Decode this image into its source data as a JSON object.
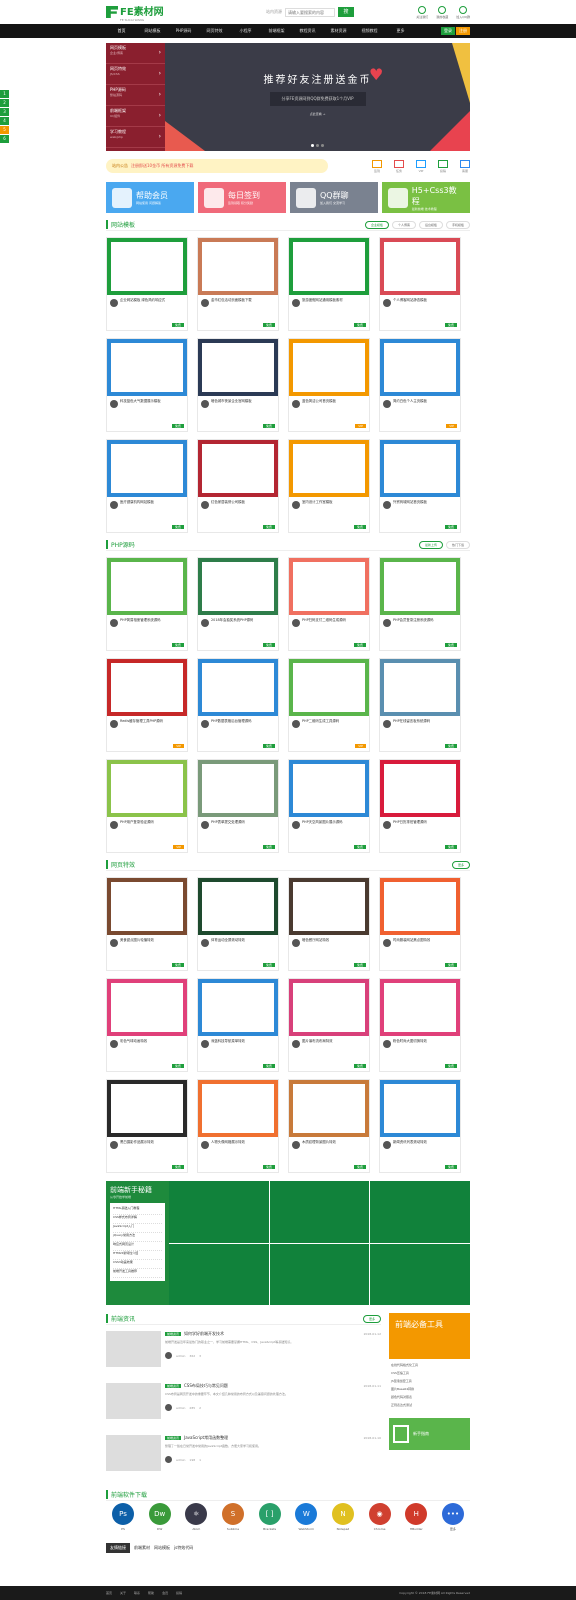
{
  "header": {
    "logo_main": "FE素材网",
    "logo_sub": "FE SUCAI WANG",
    "search_label": "站内资源",
    "search_placeholder": "请输入要搜索的内容",
    "search_btn": "搜",
    "tools": [
      "关注我们",
      "我的收藏",
      "加入QQ群"
    ]
  },
  "nav": {
    "items": [
      "首页",
      "网站模板",
      "PHP源码",
      "网页特效",
      "小程序",
      "前端框架",
      "教程资讯",
      "素材资源",
      "视频教程",
      "更多"
    ],
    "login": "登录",
    "register": "注册"
  },
  "side_tabs": [
    "1",
    "2",
    "3",
    "4",
    "5",
    "6"
  ],
  "banner": {
    "menu": [
      {
        "t": "网页模板",
        "s": "企业/博客"
      },
      {
        "t": "网页特效",
        "s": "JS/CSS"
      },
      {
        "t": "PHP源码",
        "s": "整站源码"
      },
      {
        "t": "前端框架",
        "s": "UI/组件"
      },
      {
        "t": "学习教程",
        "s": "web/php"
      }
    ],
    "title": "推荐好友注册送金币",
    "sub": "分享FE资源网到QQ群免费获取1个月VIP",
    "link": "点此查看 →"
  },
  "notice": {
    "label": "站内公告",
    "text": "注册即送10金币 所有资源免费下载"
  },
  "quick": [
    "签到",
    "任务",
    "VIP",
    "投稿",
    "客服"
  ],
  "promos": [
    {
      "t": "帮助会员",
      "s": "网站使用 问题解答",
      "c": "#4aa8f0"
    },
    {
      "t": "每日签到",
      "s": "签到领取 积分奖励",
      "c": "#f06a7a"
    },
    {
      "t": "QQ群聊",
      "s": "加入我们 交流学习",
      "c": "#7a8290"
    },
    {
      "t": "H5+Css3教程",
      "s": "最新前端 技术教程",
      "c": "#7ac043"
    }
  ],
  "sections": [
    {
      "title": "网站模板",
      "tabs": [
        "企业模板",
        "个人博客",
        "后台模板",
        "手机模板"
      ],
      "cards": [
        [
          "#1e9e3c",
          "企业网站模板 绿色简约响应式",
          "免费"
        ],
        [
          "#c97a56",
          "金币红包活动页面模板下载",
          "免费"
        ],
        [
          "#1e9e3c",
          "旅游度假网站通用模板素材",
          "免费"
        ],
        [
          "#d94a55",
          "个人博客网站静态模板",
          "免费"
        ],
        [
          "#2d89d6",
          "科技蓝色大气数据展示模板",
          "免费"
        ],
        [
          "#2b3a55",
          "暗色城市夜景企业官网模板",
          "免费"
        ],
        [
          "#f39800",
          "蓝色简洁公司首页模板",
          "VIP"
        ],
        [
          "#2d89d6",
          "简约白色个人主页模板",
          "VIP"
        ],
        [
          "#2d89d6",
          "医疗健康机构网站模板",
          "免费"
        ],
        [
          "#b32632",
          "红色家居装修公司模板",
          "免费"
        ],
        [
          "#f39800",
          "室内设计工作室模板",
          "免费"
        ],
        [
          "#2d89d6",
          "外贸商城网站首页模板",
          "免费"
        ]
      ]
    },
    {
      "title": "PHP源码",
      "tabs": [
        "最新上传",
        "热门下载"
      ],
      "cards": [
        [
          "#5ab54b",
          "PHP简易相册管理系统源码",
          "免费"
        ],
        [
          "#2e7d4a",
          "2018年会抽奖系统PHP源码",
          "免费"
        ],
        [
          "#f07060",
          "PHP扫码支付二维码生成源码",
          "免费"
        ],
        [
          "#5ab54b",
          "PHP会员登录注册系统源码",
          "免费"
        ],
        [
          "#c62828",
          "Redis缓存管理工具PHP源码",
          "VIP"
        ],
        [
          "#2d89d6",
          "PHP数据表格后台管理源码",
          "免费"
        ],
        [
          "#5ab54b",
          "PHP二维码生成工具源码",
          "VIP"
        ],
        [
          "#5a8fb0",
          "PHP在线留言板系统源码",
          "免费"
        ],
        [
          "#8bc34a",
          "PHP用户登录验证源码",
          "VIP"
        ],
        [
          "#7a9a7a",
          "PHP表单提交处理源码",
          "免费"
        ],
        [
          "#2d89d6",
          "PHP天空风景图片展示源码",
          "免费"
        ],
        [
          "#d81b3c",
          "PHP日历排班管理源码",
          "免费"
        ]
      ]
    },
    {
      "title": "网页特效",
      "tabs": [
        "更多"
      ],
      "cards": [
        [
          "#7a4a30",
          "美食甜点图片轮播特效",
          "免费"
        ],
        [
          "#1e4a2e",
          "体育运动全屏滚动特效",
          "免费"
        ],
        [
          "#4a3a30",
          "暗色餐厅网站特效",
          "免费"
        ],
        [
          "#f06030",
          "时尚服装网站焦点图特效",
          "免费"
        ],
        [
          "#e0407a",
          "彩色气球动画特效",
          "免费"
        ],
        [
          "#2d89d6",
          "深蓝科技导航菜单特效",
          "免费"
        ],
        [
          "#d8407a",
          "图片瀑布流布局特效",
          "免费"
        ],
        [
          "#e0407a",
          "粉色时尚大图切换特效",
          "免费"
        ],
        [
          "#2a2a2a",
          "黑白摄影作品展示特效",
          "免费"
        ],
        [
          "#f07030",
          "人物头像网格展示特效",
          "免费"
        ],
        [
          "#c87a3a",
          "木质纹理背景图片特效",
          "免费"
        ],
        [
          "#2d89d6",
          "新闻资讯列表滚动特效",
          "免费"
        ]
      ]
    }
  ],
  "feature": {
    "title": "前端新手秘籍",
    "sub": "从零开始学前端",
    "items": [
      "HTML基础入门教程",
      "CSS样式布局详解",
      "JavaScript入门",
      "jQuery常用方法",
      "响应式网页设计",
      "HTML5新特性介绍",
      "CSS3动画效果",
      "前端开发工具推荐"
    ]
  },
  "articles": {
    "title": "前端资讯",
    "more": "更多",
    "items": [
      {
        "tag": "前端资讯",
        "title": "如何学好前端开发技术",
        "date": "2018-01-12",
        "desc": "前端开发是近年来最热门的职业之一，学习前端需要掌握HTML、CSS、JavaScript等基础知识。",
        "author": "admin",
        "views": "362",
        "likes": "3"
      },
      {
        "tag": "前端资讯",
        "title": "CSS布局技巧与常见问题",
        "date": "2018-01-11",
        "desc": "CSS布局是网页开发中的重要环节，本文介绍几种常用的布局方式以及兼容问题的处理方法。",
        "author": "admin",
        "views": "285",
        "likes": "2"
      },
      {
        "tag": "前端资讯",
        "title": "JavaScript常用函数整理",
        "date": "2018-01-10",
        "desc": "整理了一些在日常开发中常用的JavaScript函数，方便大家学习和使用。",
        "author": "admin",
        "views": "198",
        "likes": "1"
      }
    ]
  },
  "tools_box": {
    "title": "前端必备工具",
    "items": [
      "在线代码格式化工具",
      "CSS压缩工具",
      "JS混淆加密工具",
      "图片Base64转换",
      "颜色代码对照表",
      "正则表达式测试"
    ],
    "guide": "新手指南"
  },
  "software": {
    "title": "前端软件下载",
    "items": [
      {
        "n": "PS",
        "i": "Ps",
        "c": "#0c5fa8"
      },
      {
        "n": "DW",
        "i": "Dw",
        "c": "#3a9a3a"
      },
      {
        "n": "Atom",
        "i": "⚛",
        "c": "#3a3a4a"
      },
      {
        "n": "Sublime",
        "i": "S",
        "c": "#d0702a"
      },
      {
        "n": "Brackets",
        "i": "[ ]",
        "c": "#2aa06a"
      },
      {
        "n": "WebStorm",
        "i": "W",
        "c": "#1a7ad8"
      },
      {
        "n": "Notepad",
        "i": "N",
        "c": "#e0c020"
      },
      {
        "n": "Chrome",
        "i": "◉",
        "c": "#d04030"
      },
      {
        "n": "HBuilder",
        "i": "H",
        "c": "#d03a2a"
      },
      {
        "n": "更多",
        "i": "•••",
        "c": "#2d6ad8"
      }
    ]
  },
  "links": {
    "title": "友情链接",
    "items": [
      "前端素材",
      "网站模板",
      "js特效代码"
    ]
  },
  "footer": {
    "items": [
      "首页",
      "关于",
      "联系",
      "帮助",
      "会员",
      "投稿"
    ],
    "copyright": "Copyright © 2018 FE素材网 All Rights Reserved"
  }
}
